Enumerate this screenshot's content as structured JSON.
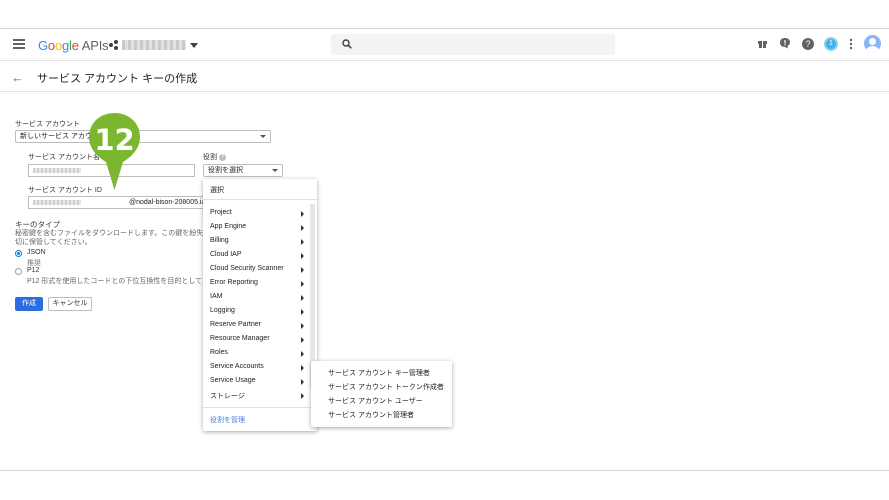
{
  "topbar": {
    "menu_icon": "hamburger-icon",
    "logo": {
      "g": "G",
      "o1": "o",
      "o2": "o",
      "g2": "g",
      "l": "l",
      "e": "e",
      "apis": "APIs"
    },
    "project_icon": "project-dots-icon",
    "search_icon": "search-icon",
    "icons": [
      "gift-icon",
      "notification-icon",
      "help-icon",
      "user-badge-icon",
      "more-vert-icon",
      "avatar-icon"
    ],
    "help_glyph": "?",
    "badge_text": "1",
    "notif_glyph": "!"
  },
  "header": {
    "back_icon": "←",
    "title": "サービス アカウント キーの作成"
  },
  "form": {
    "service_account_label": "サービス アカウント",
    "service_account_value": "新しいサービス アカウント",
    "sa_name_label": "サービス アカウント名",
    "role_label": "役割",
    "role_select_value": "役割を選択",
    "sa_id_label": "サービス アカウント ID",
    "sa_id_suffix": "@nodal-bison-208005.iam.gs",
    "key_type_label": "キーのタイプ",
    "key_type_desc_1": "秘密鍵を含むファイルをダウンロードします。この鍵を紛失すると",
    "key_type_desc_2": "切に保管してください。",
    "json_label": "JSON",
    "json_sub": "推奨",
    "p12_label": "P12",
    "p12_sub": "P12 形式を使用したコードとの下位互換性を目的としていま",
    "create_button": "作成",
    "cancel_button": "キャンセル"
  },
  "role_menu": {
    "header": "選択",
    "items": [
      "Project",
      "App Engine",
      "Billing",
      "Cloud IAP",
      "Cloud Security Scanner",
      "Error Reporting",
      "IAM",
      "Logging",
      "Reserve Partner",
      "Resource Manager",
      "Roles",
      "Service Accounts",
      "Service Usage",
      "ストレージ"
    ],
    "manage_link": "役割を管理"
  },
  "service_accounts_submenu": {
    "items": [
      "サービス アカウント キー管理者",
      "サービス アカウント トークン作成者",
      "サービス アカウント ユーザー",
      "サービス アカウント管理者"
    ]
  },
  "step_marker": {
    "label": "12",
    "color": "#7cb82f"
  }
}
